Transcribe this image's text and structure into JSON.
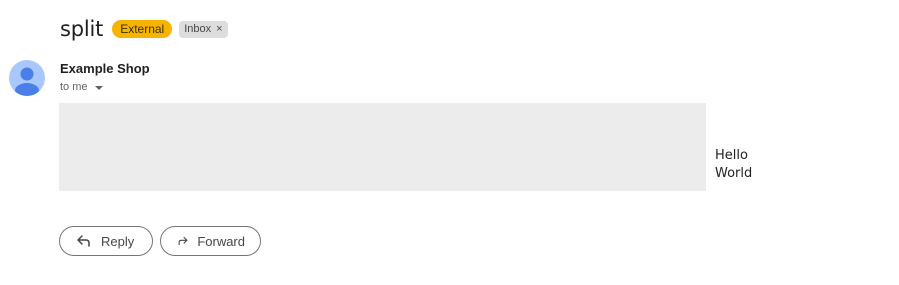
{
  "subject": {
    "title": "split",
    "labels": {
      "external": "External",
      "inbox": "Inbox",
      "inbox_remove": "×"
    }
  },
  "message": {
    "sender_name": "Example Shop",
    "recipients": "to me",
    "body_lines": [
      "Hello",
      "World"
    ]
  },
  "actions": {
    "reply_label": "Reply",
    "forward_label": "Forward"
  },
  "colors": {
    "external_badge": "#f6b400",
    "inbox_badge": "#dddddd",
    "avatar_bg": "#a8c7fa",
    "avatar_fg": "#4a7ee8",
    "image_placeholder": "#ececec"
  },
  "icons": {
    "avatar": "person-icon",
    "recipients_toggle": "caret-down-icon",
    "reply": "reply-arrow-icon",
    "forward": "forward-arrow-icon"
  }
}
